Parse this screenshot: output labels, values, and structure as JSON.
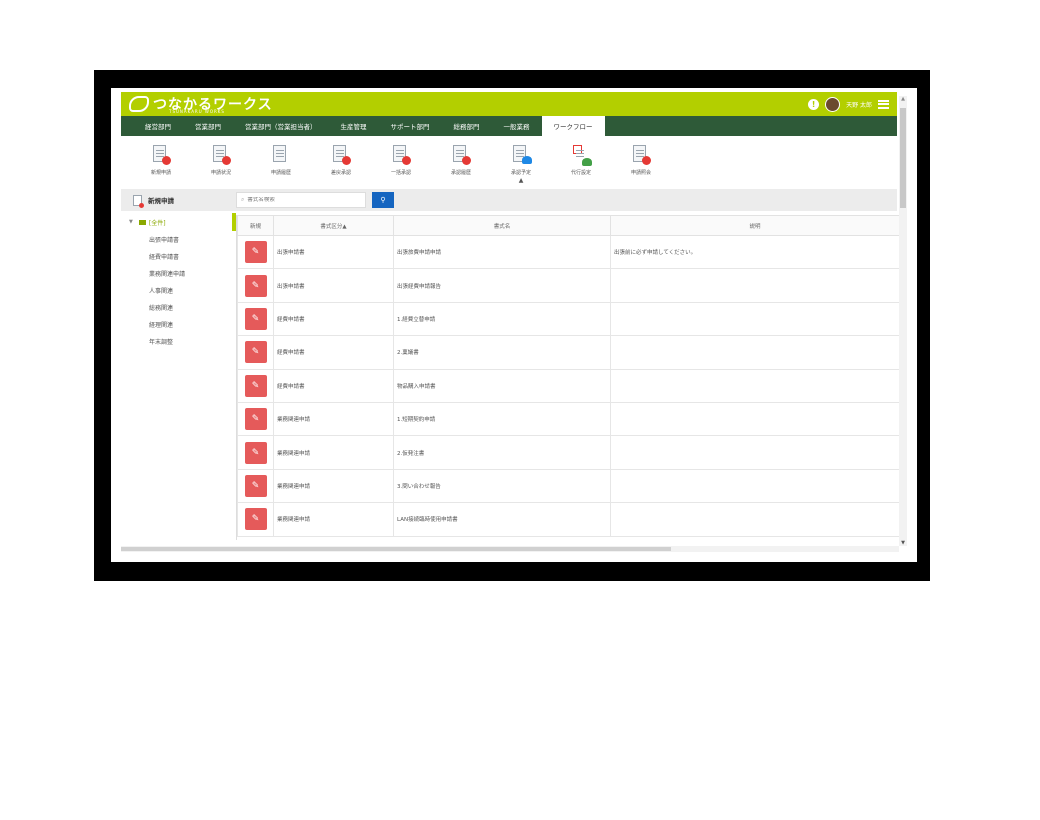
{
  "app": {
    "logo_text": "つなかるワークス",
    "logo_sub": "TSUNAKARU WORKS"
  },
  "user": {
    "name": "天野 太郎"
  },
  "nav": {
    "items": [
      {
        "label": "経営部門"
      },
      {
        "label": "営業部門"
      },
      {
        "label": "営業部門（営業担当者）"
      },
      {
        "label": "生産管理"
      },
      {
        "label": "サポート部門"
      },
      {
        "label": "総務部門"
      },
      {
        "label": "一般業務"
      },
      {
        "label": "ワークフロー",
        "active": true
      }
    ]
  },
  "toolbar": {
    "items": [
      {
        "label": "新規申請",
        "badge": "red"
      },
      {
        "label": "申請状況",
        "badge": "red"
      },
      {
        "label": "申請履歴",
        "badge": "none"
      },
      {
        "label": "差戻承認",
        "badge": "red"
      },
      {
        "label": "一括承認",
        "badge": "red"
      },
      {
        "label": "承認履歴",
        "badge": "red"
      },
      {
        "label": "承認予定",
        "badge": "blue",
        "active": true
      },
      {
        "label": "代行設定",
        "badge": "green"
      },
      {
        "label": "申請照会",
        "badge": "red"
      }
    ]
  },
  "page": {
    "title": "新規申請"
  },
  "search": {
    "placeholder": "書式名検索"
  },
  "tree": {
    "root": "[全件]",
    "items": [
      "出張申請書",
      "経費申請書",
      "業務関連申請",
      "人事関連",
      "総務関連",
      "経理関連",
      "年末調整"
    ]
  },
  "table": {
    "headers": {
      "new": "新規",
      "category": "書式区分▲",
      "name": "書式名",
      "desc": "説明"
    },
    "rows": [
      {
        "category": "出張申請書",
        "name": "出張旅費申請申請",
        "desc": "出張前に必ず申請してください。"
      },
      {
        "category": "出張申請書",
        "name": "出張経費申請報告",
        "desc": ""
      },
      {
        "category": "経費申請書",
        "name": "1.経費立替申請",
        "desc": ""
      },
      {
        "category": "経費申請書",
        "name": "2.稟議書",
        "desc": ""
      },
      {
        "category": "経費申請書",
        "name": "物品購入申請書",
        "desc": ""
      },
      {
        "category": "業務関連申請",
        "name": "1.短期契約申請",
        "desc": ""
      },
      {
        "category": "業務関連申請",
        "name": "2.仮発注書",
        "desc": ""
      },
      {
        "category": "業務関連申請",
        "name": "3.問い合わせ報告",
        "desc": ""
      },
      {
        "category": "業務関連申請",
        "name": "LAN接続臨時使用申請書",
        "desc": ""
      }
    ]
  },
  "colors": {
    "brand": "#b3cf00",
    "nav": "#2e5a38",
    "edit": "#e55a5a",
    "search_btn": "#1565c0"
  }
}
